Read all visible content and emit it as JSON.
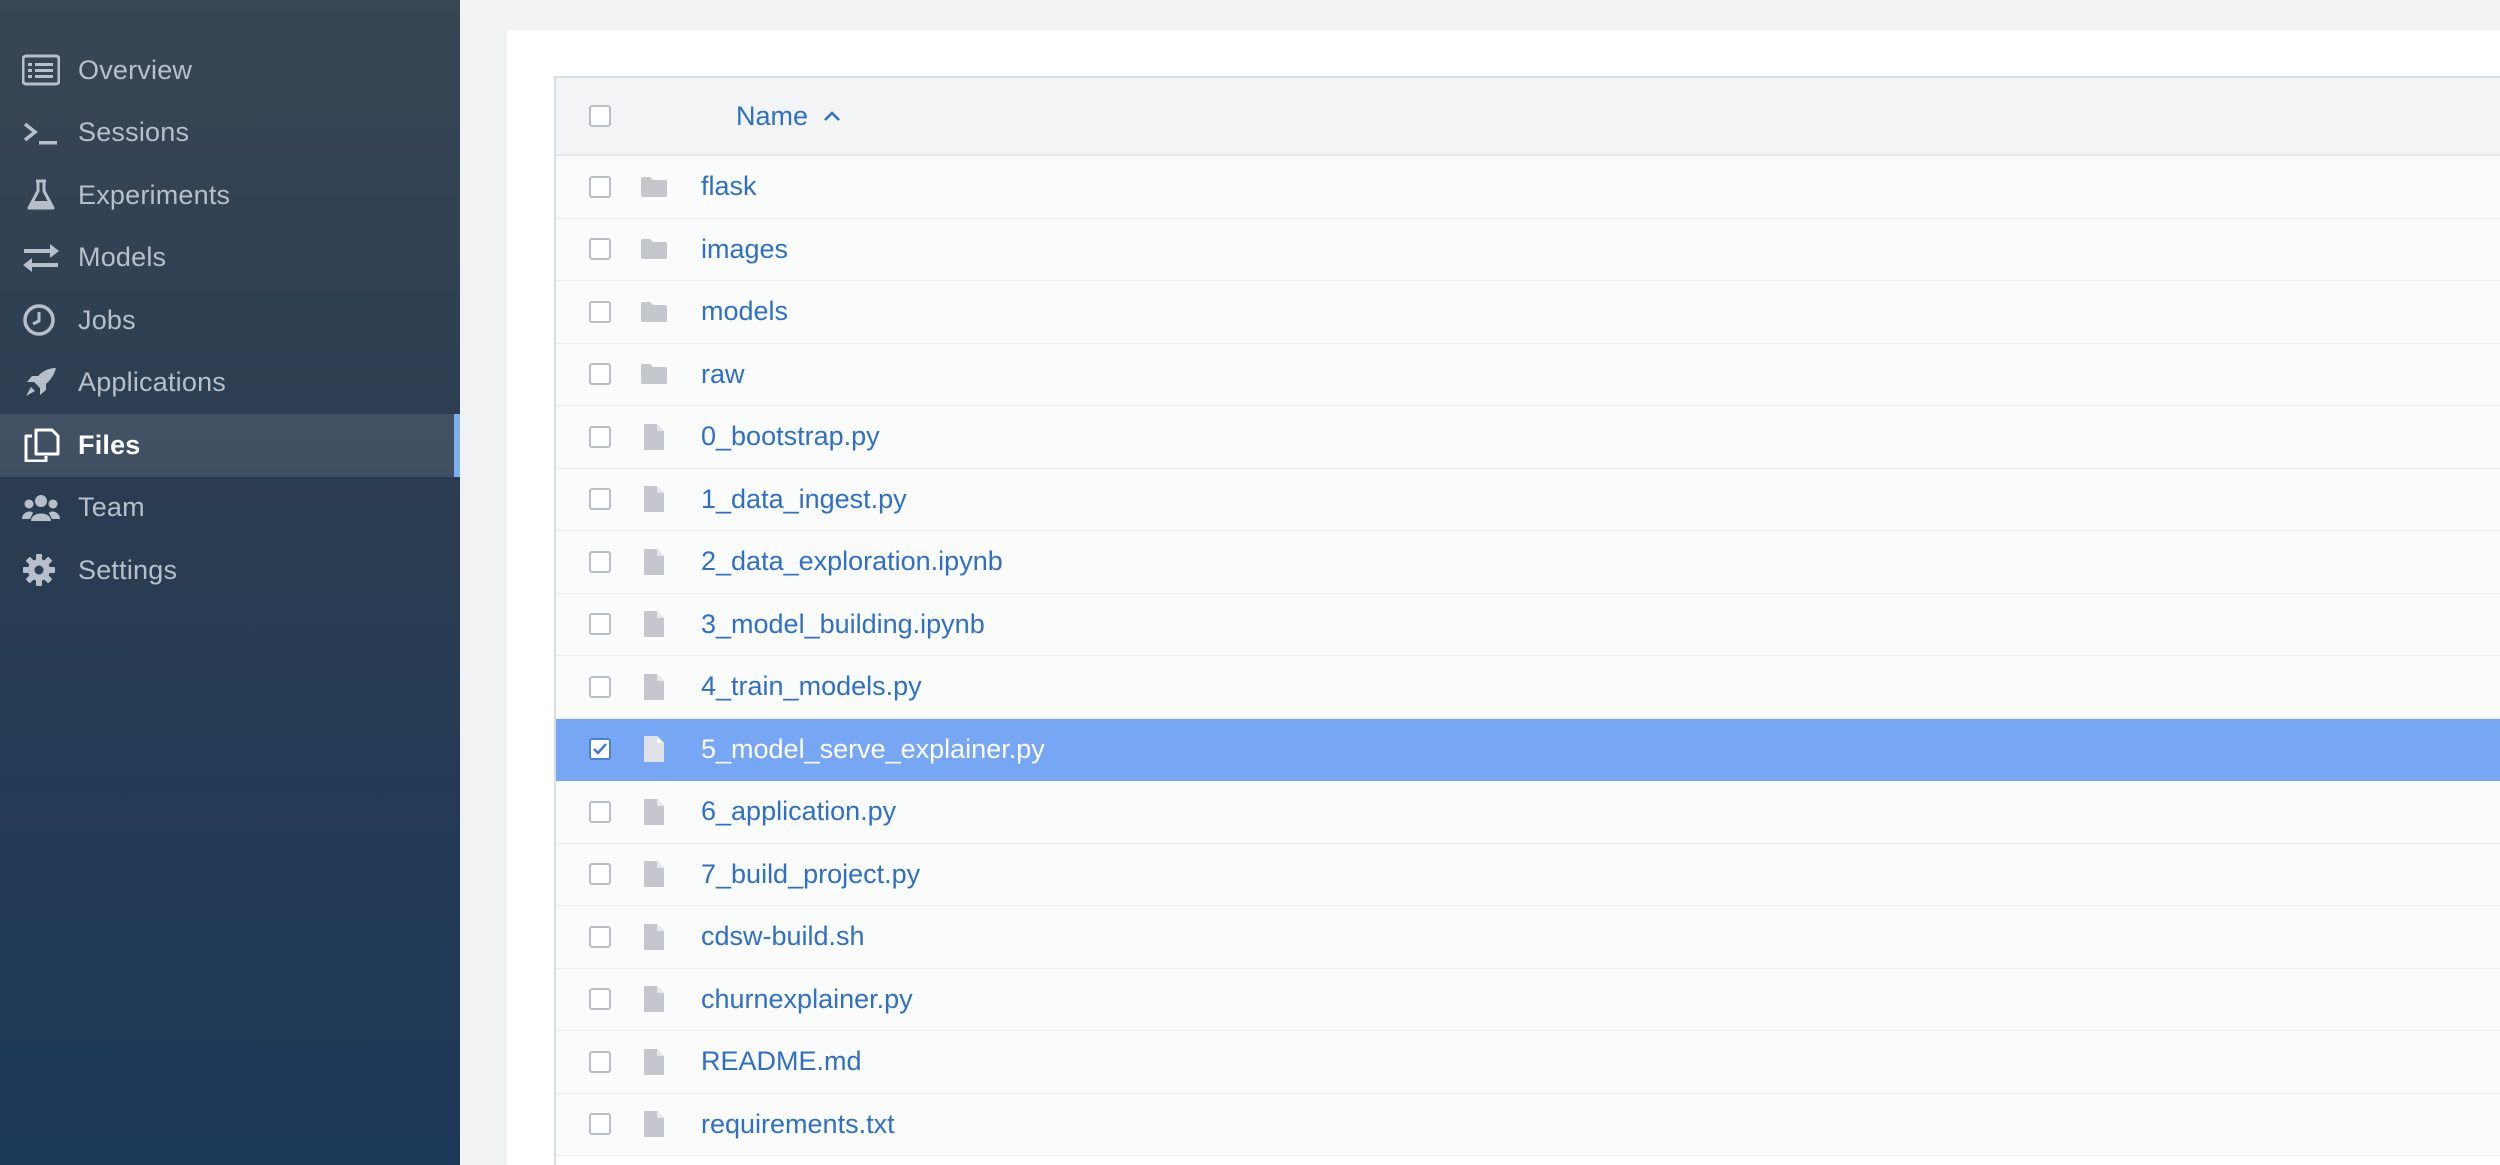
{
  "sidebar": {
    "items": [
      {
        "label": "Overview",
        "icon": "list-icon"
      },
      {
        "label": "Sessions",
        "icon": "terminal-icon"
      },
      {
        "label": "Experiments",
        "icon": "flask-icon"
      },
      {
        "label": "Models",
        "icon": "arrows-icon"
      },
      {
        "label": "Jobs",
        "icon": "clock-icon"
      },
      {
        "label": "Applications",
        "icon": "rocket-icon"
      },
      {
        "label": "Files",
        "icon": "files-icon",
        "active": true
      },
      {
        "label": "Team",
        "icon": "team-icon"
      },
      {
        "label": "Settings",
        "icon": "gear-icon"
      }
    ]
  },
  "table": {
    "header": {
      "name_label": "Name",
      "sort": "ascending"
    },
    "rows": [
      {
        "name": "flask",
        "type": "folder"
      },
      {
        "name": "images",
        "type": "folder"
      },
      {
        "name": "models",
        "type": "folder"
      },
      {
        "name": "raw",
        "type": "folder"
      },
      {
        "name": "0_bootstrap.py",
        "type": "file"
      },
      {
        "name": "1_data_ingest.py",
        "type": "file"
      },
      {
        "name": "2_data_exploration.ipynb",
        "type": "file"
      },
      {
        "name": "3_model_building.ipynb",
        "type": "file"
      },
      {
        "name": "4_train_models.py",
        "type": "file"
      },
      {
        "name": "5_model_serve_explainer.py",
        "type": "file",
        "selected": true
      },
      {
        "name": "6_application.py",
        "type": "file"
      },
      {
        "name": "7_build_project.py",
        "type": "file"
      },
      {
        "name": "cdsw-build.sh",
        "type": "file"
      },
      {
        "name": "churnexplainer.py",
        "type": "file"
      },
      {
        "name": "README.md",
        "type": "file"
      },
      {
        "name": "requirements.txt",
        "type": "file"
      }
    ]
  },
  "colors": {
    "link": "#2f6fc6",
    "selected_row": "#77a6f5",
    "sidebar_active_accent": "#7fb0ee"
  }
}
